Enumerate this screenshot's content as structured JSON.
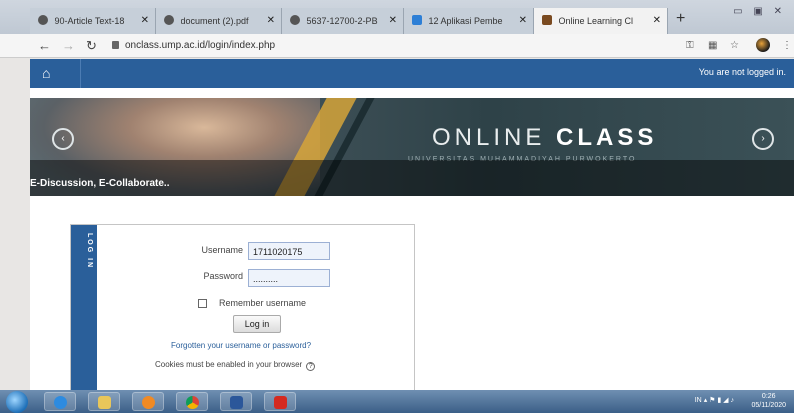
{
  "browser": {
    "tabs": [
      {
        "label": "90-Article Text-18",
        "active": false
      },
      {
        "label": "document (2).pdf",
        "active": false
      },
      {
        "label": "5637-12700-2-PB",
        "active": false
      },
      {
        "label": "12 Aplikasi Pembel",
        "active": false
      },
      {
        "label": "Online Learning Cl",
        "active": true
      }
    ],
    "new_tab": "+",
    "address": "onclass.ump.ac.id/login/index.php"
  },
  "navbar": {
    "not_logged_in": "You are not logged in."
  },
  "banner": {
    "title_light": "ONLINE",
    "title_bold": "CLASS",
    "subtitle": "UNIVERSITAS MUHAMMADIYAH PURWOKERTO",
    "caption": "E-Discussion, E-Collaborate.."
  },
  "login": {
    "sidebar_label": "LOG IN",
    "username_label": "Username",
    "username_value": "1711020175",
    "password_label": "Password",
    "password_value": "..........",
    "remember_label": "Remember username",
    "login_button": "Log in",
    "forgot_link": "Forgotten your username or password?",
    "cookies_note": "Cookies must be enabled in your browser"
  },
  "taskbar": {
    "tray": "IN",
    "time": "0:26",
    "date": "05/11/2020"
  },
  "colors": {
    "navbar": "#2a5f9a",
    "link": "#2a5f9a",
    "banner_accent": "#d6a43a"
  }
}
